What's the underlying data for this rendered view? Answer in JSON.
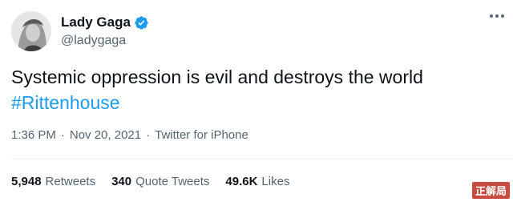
{
  "author": {
    "name": "Lady Gaga",
    "handle": "@ladygaga",
    "verified": true
  },
  "tweet": {
    "text": "Systemic oppression is evil and destroys the world",
    "hashtag": "#Rittenhouse"
  },
  "meta": {
    "time": "1:36 PM",
    "separator": "·",
    "date": "Nov 20, 2021",
    "source": "Twitter for iPhone"
  },
  "stats": {
    "retweets_count": "5,948",
    "retweets_label": "Retweets",
    "quotes_count": "340",
    "quotes_label": "Quote Tweets",
    "likes_count": "49.6K",
    "likes_label": "Likes"
  },
  "watermark": "正解局",
  "colors": {
    "accent": "#1d9bf0",
    "secondary_text": "#536471",
    "primary_text": "#0f1419"
  },
  "icons": {
    "verified": "verified-badge-icon",
    "more": "more-options-icon"
  }
}
